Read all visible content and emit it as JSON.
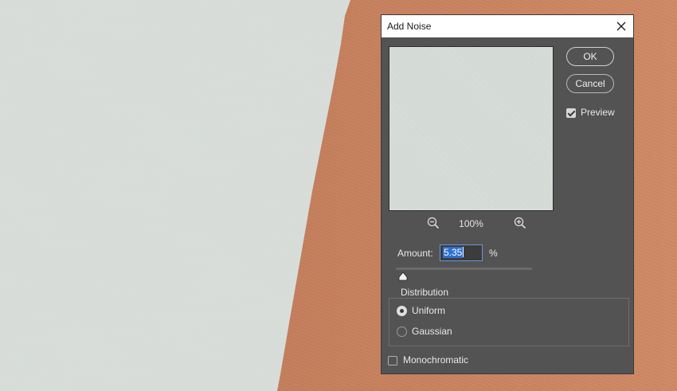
{
  "dialog": {
    "title": "Add Noise",
    "ok_label": "OK",
    "cancel_label": "Cancel",
    "preview_label": "Preview",
    "preview_checked": true,
    "zoom_level": "100%",
    "amount_label": "Amount:",
    "amount_value": "5.35",
    "amount_unit": "%",
    "distribution": {
      "legend": "Distribution",
      "options": [
        {
          "label": "Uniform",
          "selected": true
        },
        {
          "label": "Gaussian",
          "selected": false
        }
      ]
    },
    "monochromatic_label": "Monochromatic",
    "monochromatic_checked": false
  },
  "icons": {
    "close": "close-icon",
    "zoom_out": "zoom-out-icon",
    "zoom_in": "zoom-in-icon",
    "slider_thumb": "slider-thumb-icon"
  },
  "colors": {
    "dialog_bg": "#535353",
    "selection": "#2f6fd1",
    "input_focus_border": "#6f93d6"
  }
}
